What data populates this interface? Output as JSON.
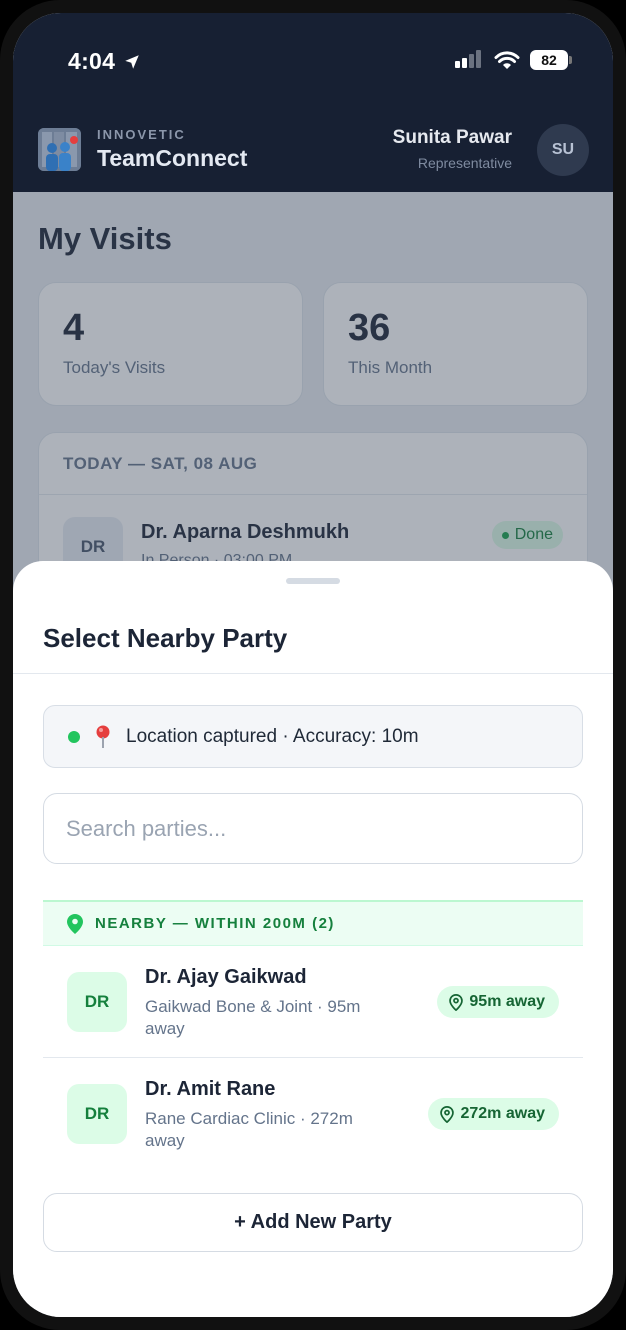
{
  "status_bar": {
    "time": "4:04",
    "battery": "82"
  },
  "header": {
    "brand_sub": "INNOVETIC",
    "brand_name": "TeamConnect",
    "user_name": "Sunita Pawar",
    "user_role": "Representative",
    "avatar_initials": "SU"
  },
  "page": {
    "title": "My Visits",
    "stats": [
      {
        "value": "4",
        "label": "Today's Visits"
      },
      {
        "value": "36",
        "label": "This Month"
      }
    ],
    "visits": {
      "date_header": "TODAY — SAT, 08 AUG",
      "first": {
        "initials": "DR",
        "name": "Dr. Aparna Deshmukh",
        "meta": "In Person · 03:00 PM",
        "status": "Done"
      }
    }
  },
  "sheet": {
    "title": "Select Nearby Party",
    "location_text": "Location captured · Accuracy: 10m",
    "search_placeholder": "Search parties...",
    "section_label": "NEARBY — WITHIN 200M (2)",
    "parties": [
      {
        "initials": "DR",
        "name": "Dr. Ajay Gaikwad",
        "meta": "Gaikwad Bone & Joint · 95m away",
        "distance": "95m away"
      },
      {
        "initials": "DR",
        "name": "Dr. Amit Rane",
        "meta": "Rane Cardiac Clinic · 272m away",
        "distance": "272m away"
      }
    ],
    "add_button": "+ Add New Party"
  },
  "colors": {
    "header_bg": "#172033",
    "accent_green": "#15803d",
    "green_bg": "#dcfce7"
  }
}
